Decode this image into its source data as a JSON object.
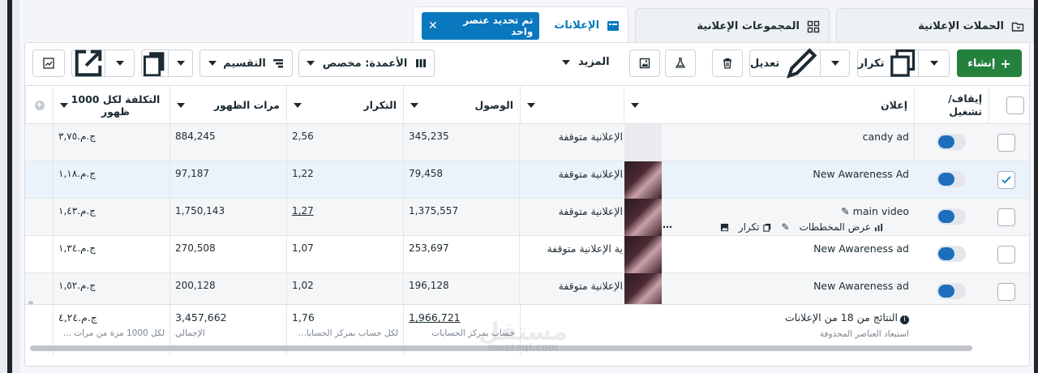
{
  "tabs": [
    {
      "label": "الحملات الإعلانية",
      "icon": "folder-icon"
    },
    {
      "label": "المجموعات الإعلانية",
      "icon": "grid-icon"
    },
    {
      "label": "الإعلانات",
      "icon": "ad-icon",
      "badge": "تم تحديد عنصر واحد"
    }
  ],
  "toolbar": {
    "create": "إنشاء",
    "duplicate": "تكرار",
    "edit": "تعديل",
    "more": "المزيد",
    "columns": "الأعمدة: مخصص",
    "breakdown": "التقسيم"
  },
  "headers": {
    "toggle": "إيقاف/ تشغيل",
    "ad": "إعلان",
    "reach": "الوصول",
    "frequency": "التكرار",
    "impressions": "مرات الظهور",
    "cpm": "التكلفة لكل 1000 ظهور"
  },
  "rows": [
    {
      "name": "candy ad",
      "status": "الإعلانية متوقفة",
      "reach": "345,235",
      "frequency": "2,56",
      "impressions": "884,245",
      "cpm": "ج.م.٣,٧٥",
      "selected": false
    },
    {
      "name": "New Awareness Ad",
      "status": "الإعلانية متوقفة",
      "reach": "79,458",
      "frequency": "1,22",
      "impressions": "97,187",
      "cpm": "ج.م.١,١٨",
      "selected": true
    },
    {
      "name": "main video",
      "status": "الإعلانية متوقفة",
      "reach": "1,375,557",
      "frequency": "1,27",
      "impressions": "1,750,143",
      "cpm": "ج.م.١,٤٣",
      "selected": false
    },
    {
      "name": "New Awareness ad",
      "status": "ية الإعلانية متوقفة",
      "reach": "253,697",
      "frequency": "1,07",
      "impressions": "270,508",
      "cpm": "ج.م.١,٣٤",
      "selected": false
    },
    {
      "name": "New Awareness ad",
      "status": "الإعلانية متوقفة",
      "reach": "196,128",
      "frequency": "1,02",
      "impressions": "200,128",
      "cpm": "ج.م.١,٥٢",
      "selected": false
    }
  ],
  "hover_actions": {
    "charts": "عرض المخططات",
    "duplicate": "تكرار"
  },
  "footer": {
    "title": "النتائج من 18 من الإعلانات",
    "subtitle": "استبعاد العناصر المحذوفة",
    "reach": "1,966,721",
    "reach_sub": "حساب بمركز الحسابات",
    "frequency": "1,76",
    "frequency_sub": "لكل حساب بمركز الحسابا...",
    "impressions": "3,457,662",
    "impressions_sub": "الإجمالي",
    "cpm": "ج.م.٤,٢٤",
    "cpm_sub": "لكل 1000 مرة من مرات ..."
  },
  "watermark": {
    "main": "مستقل",
    "sub": "mostaql.com"
  }
}
